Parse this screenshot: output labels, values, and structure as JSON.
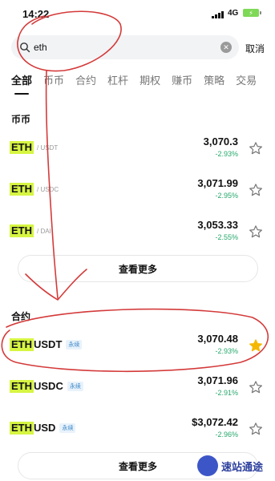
{
  "status_bar": {
    "time": "14:22",
    "network": "4G"
  },
  "search": {
    "value": "eth",
    "cancel_label": "取消"
  },
  "tabs": [
    {
      "label": "全部",
      "active": true
    },
    {
      "label": "币币",
      "active": false
    },
    {
      "label": "合约",
      "active": false
    },
    {
      "label": "杠杆",
      "active": false
    },
    {
      "label": "期权",
      "active": false
    },
    {
      "label": "赚币",
      "active": false
    },
    {
      "label": "策略",
      "active": false
    },
    {
      "label": "交易",
      "active": false
    }
  ],
  "spot": {
    "title": "币币",
    "rows": [
      {
        "base": "ETH",
        "quote": "/ USDT",
        "price": "3,070.3",
        "change": "-2.93%",
        "starred": false
      },
      {
        "base": "ETH",
        "quote": "/ USDC",
        "price": "3,071.99",
        "change": "-2.95%",
        "starred": false
      },
      {
        "base": "ETH",
        "quote": "/ DAI",
        "price": "3,053.33",
        "change": "-2.55%",
        "starred": false
      }
    ],
    "more_label": "查看更多"
  },
  "futures": {
    "title": "合约",
    "rows": [
      {
        "base": "ETH",
        "rest": "USDT",
        "badge": "永续",
        "price": "3,070.48",
        "change": "-2.93%",
        "starred": true
      },
      {
        "base": "ETH",
        "rest": "USDC",
        "badge": "永续",
        "price": "3,071.96",
        "change": "-2.91%",
        "starred": false
      },
      {
        "base": "ETH",
        "rest": "USD",
        "badge": "永续",
        "price": "$3,072.42",
        "change": "-2.96%",
        "starred": false
      }
    ],
    "more_label": "查看更多"
  },
  "watermark": {
    "text": "速站通途"
  },
  "colors": {
    "highlight": "#d6f542",
    "negative_change": "#25a86b",
    "star_active": "#f5b800",
    "annotation": "#d43a3a"
  }
}
